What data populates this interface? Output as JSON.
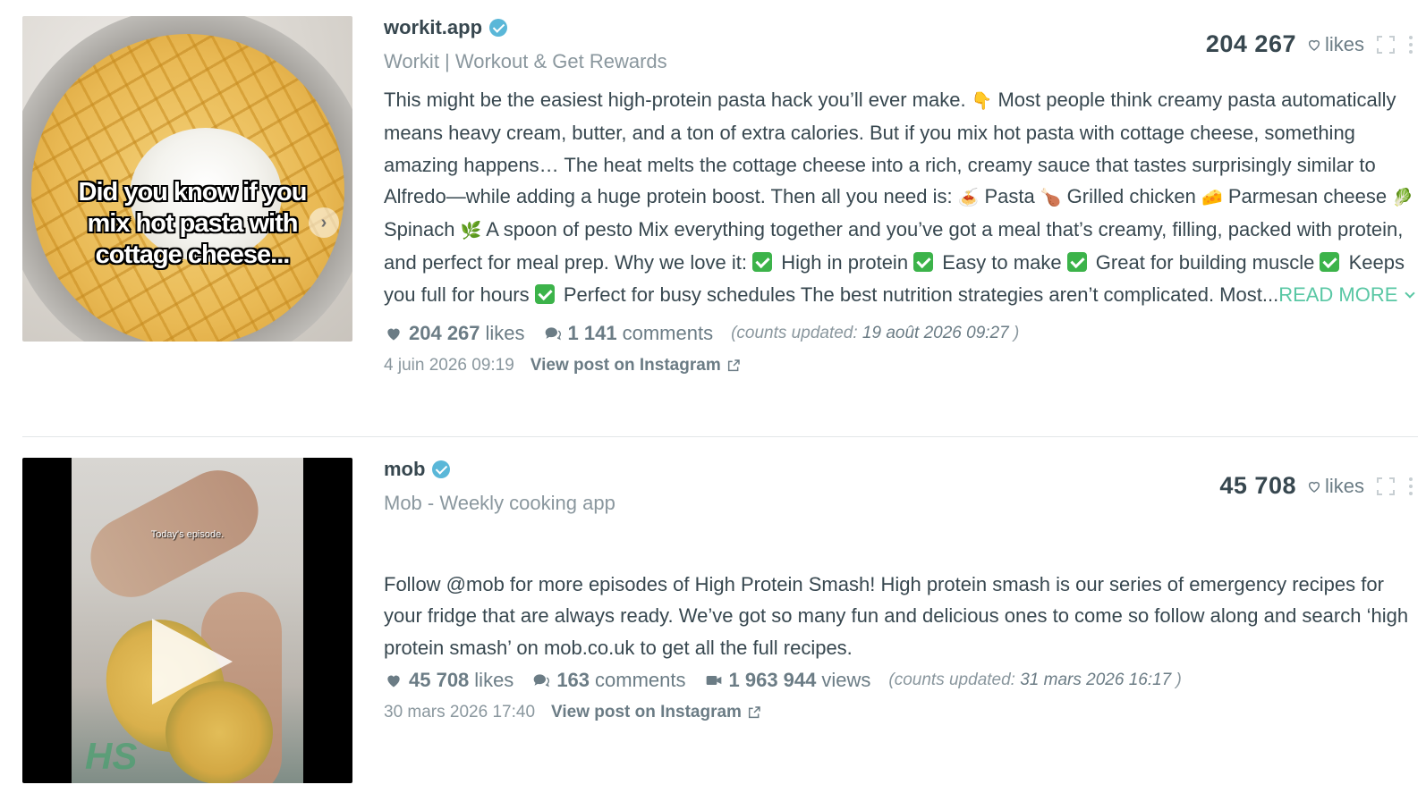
{
  "posts": [
    {
      "author": "workit.app",
      "full_name": "Workit | Workout & Get Rewards",
      "top_count": "204 267",
      "top_likes_label": "likes",
      "thumbnail_overlay": "Did you know if you mix hot pasta with cottage cheese...",
      "text_segments": [
        "This might be the easiest high-protein pasta hack you’ll ever make. ",
        "👇",
        " Most people think creamy pasta automatically means heavy cream, butter, and a ton of extra calories. But if you mix hot pasta with cottage cheese, something amazing happens… The heat melts the cottage cheese into a rich, creamy sauce that tastes surprisingly similar to Alfredo—while adding a huge protein boost. Then all you need is: ",
        "🍝",
        " Pasta ",
        "🍗",
        " Grilled chicken ",
        "🧀",
        " Parmesan cheese ",
        "🥬",
        " Spinach ",
        "🌿",
        " A spoon of pesto Mix everything together and you’ve got a meal that’s creamy, filling, packed with protein, and perfect for meal prep. Why we love it: ",
        " High in protein ",
        " Easy to make ",
        " Great for building muscle ",
        " Keeps you full for hours ",
        " Perfect for busy schedules The best nutrition strategies aren’t complicated. Most..."
      ],
      "read_more": "READ MORE",
      "likes_count": "204 267",
      "likes_label": "likes",
      "comments_count": "1 141",
      "comments_label": "comments",
      "updated_prefix": "(counts updated: ",
      "updated_value": "19 août 2026 09:27",
      "updated_suffix": " )",
      "date": "4 juin 2026 09:19",
      "link_label": "View post on Instagram"
    },
    {
      "author": "mob",
      "full_name": "Mob - Weekly cooking app",
      "top_count": "45 708",
      "top_likes_label": "likes",
      "thumbnail_caption": "Today's episode.",
      "thumbnail_watermark": "HS",
      "text": "Follow @mob for more episodes of High Protein Smash! High protein smash is our series of emergency recipes for your fridge that are always ready. We’ve got so many fun and delicious ones to come so follow along and search ‘high protein smash’ on mob.co.uk to get all the full recipes.",
      "likes_count": "45 708",
      "likes_label": "likes",
      "comments_count": "163",
      "comments_label": "comments",
      "views_count": "1 963 944",
      "views_label": "views",
      "updated_prefix": "(counts updated: ",
      "updated_value": "31 mars 2026 16:17",
      "updated_suffix": " )",
      "date": "30 mars 2026 17:40",
      "link_label": "View post on Instagram"
    }
  ],
  "colors": {
    "accent": "#59c7a4",
    "verified": "#5ab7d8",
    "text": "#37474f",
    "muted": "#8a979e"
  },
  "icons": [
    "verified-icon",
    "heart-outline-icon",
    "expand-icon",
    "more-vertical-icon",
    "heart-icon",
    "comment-icon",
    "video-icon",
    "external-link-icon",
    "chevron-down-icon",
    "play-icon",
    "chevron-right-icon",
    "check-icon"
  ]
}
